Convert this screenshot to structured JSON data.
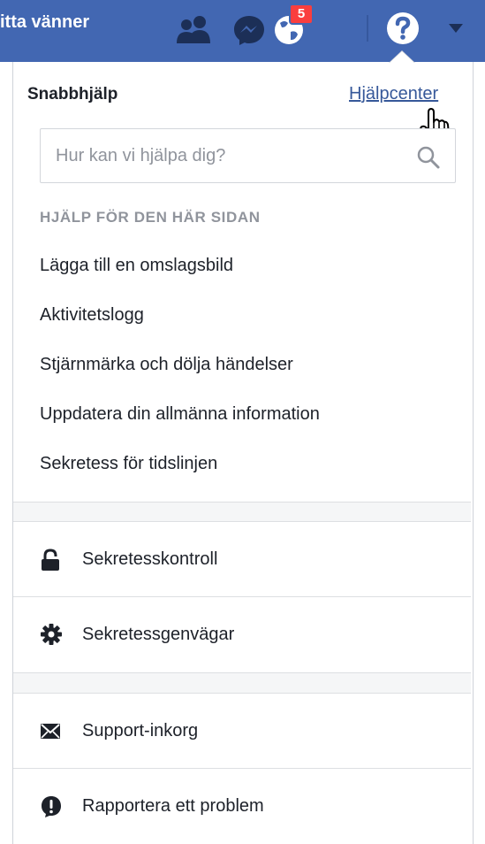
{
  "topbar": {
    "find_friends": "itta vänner",
    "notifications_count": "5",
    "icons": [
      "friends-icon",
      "messenger-icon",
      "globe-icon",
      "help-icon",
      "caret-down-icon"
    ],
    "bg_color": "#4267b2"
  },
  "dropdown": {
    "title": "Snabbhjälp",
    "help_center_link": "Hjälpcenter",
    "search": {
      "placeholder": "Hur kan vi hjälpa dig?",
      "value": ""
    },
    "section_header": "HJÄLP FÖR DEN HÄR SIDAN",
    "help_items": [
      "Lägga till en omslagsbild",
      "Aktivitetslogg",
      "Stjärnmärka och dölja händelser",
      "Uppdatera din allmänna information",
      "Sekretess för tidslinjen"
    ],
    "privacy_actions": [
      {
        "label": "Sekretesskontroll",
        "icon": "lock-icon"
      },
      {
        "label": "Sekretessgenvägar",
        "icon": "gear-icon"
      }
    ],
    "support_actions": [
      {
        "label": "Support-inkorg",
        "icon": "envelope-icon"
      },
      {
        "label": "Rapportera ett problem",
        "icon": "alert-icon"
      }
    ]
  }
}
